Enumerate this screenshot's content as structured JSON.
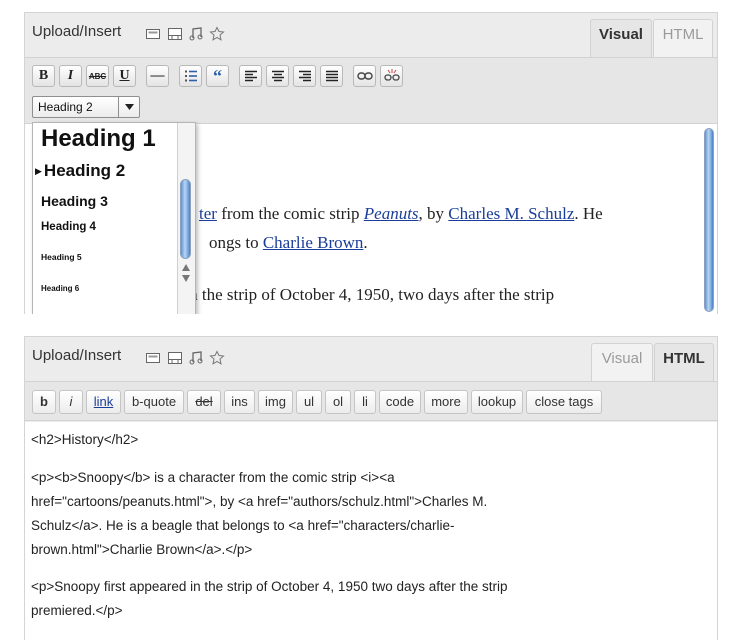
{
  "top_editor": {
    "upload_label": "Upload/Insert",
    "media_icons": [
      "image-icon",
      "video-icon",
      "audio-icon",
      "media-icon"
    ],
    "tabs": [
      {
        "label": "Visual",
        "active": true
      },
      {
        "label": "HTML",
        "active": false
      }
    ],
    "toolbar_buttons": [
      {
        "name": "bold",
        "label": "B"
      },
      {
        "name": "italic",
        "label": "I"
      },
      {
        "name": "strikethrough",
        "label": "ABC"
      },
      {
        "name": "underline",
        "label": "U"
      },
      {
        "name": "horizontal-rule",
        "label": "—"
      },
      {
        "name": "ordered-list",
        "label": ""
      },
      {
        "name": "blockquote",
        "label": "“"
      },
      {
        "name": "align-left",
        "label": ""
      },
      {
        "name": "align-center",
        "label": ""
      },
      {
        "name": "align-right",
        "label": ""
      },
      {
        "name": "align-justify",
        "label": ""
      },
      {
        "name": "link",
        "label": ""
      },
      {
        "name": "unlink",
        "label": ""
      }
    ],
    "format_select": {
      "value": "Heading 2"
    },
    "heading_dropdown": {
      "items": [
        "Heading 1",
        "Heading 2",
        "Heading 3",
        "Heading 4",
        "Heading 5",
        "Heading 6"
      ],
      "selected": "Heading 2"
    },
    "content": {
      "line1": {
        "frag1": "ter",
        "text1": " from the comic strip ",
        "link1": "Peanuts",
        "text2": ", by ",
        "link2": "Charles M. Schulz",
        "text3": ". He"
      },
      "line2": {
        "frag": "ongs to ",
        "link": "Charlie Brown",
        "end": "."
      },
      "line3": "Snoopy first appeared in the strip of October 4, 1950, two days after the strip"
    }
  },
  "bottom_editor": {
    "upload_label": "Upload/Insert",
    "media_icons": [
      "image-icon",
      "video-icon",
      "audio-icon",
      "media-icon"
    ],
    "tabs": [
      {
        "label": "Visual",
        "active": false
      },
      {
        "label": "HTML",
        "active": true
      }
    ],
    "quicktags": [
      "b",
      "i",
      "link",
      "b-quote",
      "del",
      "ins",
      "img",
      "ul",
      "ol",
      "li",
      "code",
      "more",
      "lookup",
      "close tags"
    ],
    "source_lines": [
      "<h2>History</h2>",
      "",
      "<p><b>Snoopy</b> is a character from the comic strip <i><a",
      "href=\"cartoons/peanuts.html\">, by <a href=\"authors/schulz.html\">Charles M.",
      "Schulz</a>. He is a beagle that belongs to <a href=\"characters/charlie-",
      "brown.html\">Charlie Brown</a>.</p>",
      "",
      "<p>Snoopy first appeared in the strip of October 4, 1950 two days after the strip",
      "premiered.</p>"
    ]
  }
}
